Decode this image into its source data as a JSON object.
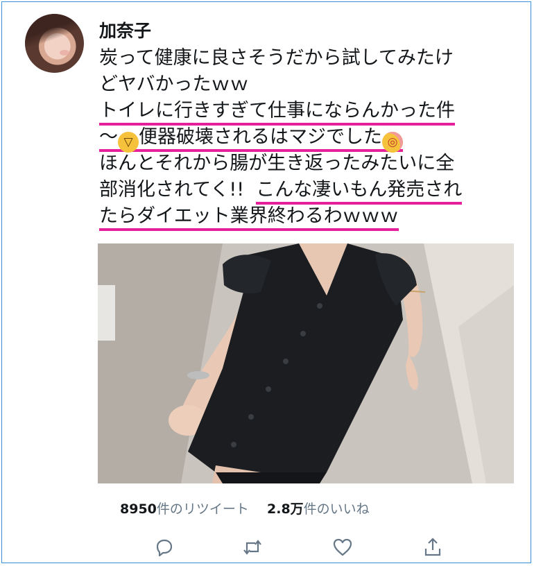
{
  "user": {
    "name": "加奈子"
  },
  "tweet": {
    "lines": [
      "炭って健康に良さそうだから試してみたけ",
      "どヤバかったｗｗ",
      "トイレに行きすぎて仕事にならんかった件",
      "〜",
      "便器破壊されるはマジでした",
      "ほんとそれから腸が生き返ったみたいに全",
      "部消化されてく!!",
      "こんな凄いもん発売され",
      "たらダイエット業界終わるわｗｗｗ"
    ],
    "emoji": {
      "laugh": "rolling-on-floor-laughing-emoji",
      "flushed": "flushed-face-emoji"
    },
    "underline_color": "#e6209a"
  },
  "stats": {
    "retweet_count": "8950",
    "retweet_label": "件のリツイート",
    "like_count": "2.8万",
    "like_label": "件のいいね"
  },
  "actions": {
    "reply": "reply-icon",
    "retweet": "retweet-icon",
    "like": "heart-icon",
    "share": "share-icon"
  },
  "colors": {
    "text": "#14171a",
    "muted": "#657786",
    "border": "#3a8fd9",
    "accent_underline": "#e6209a"
  }
}
